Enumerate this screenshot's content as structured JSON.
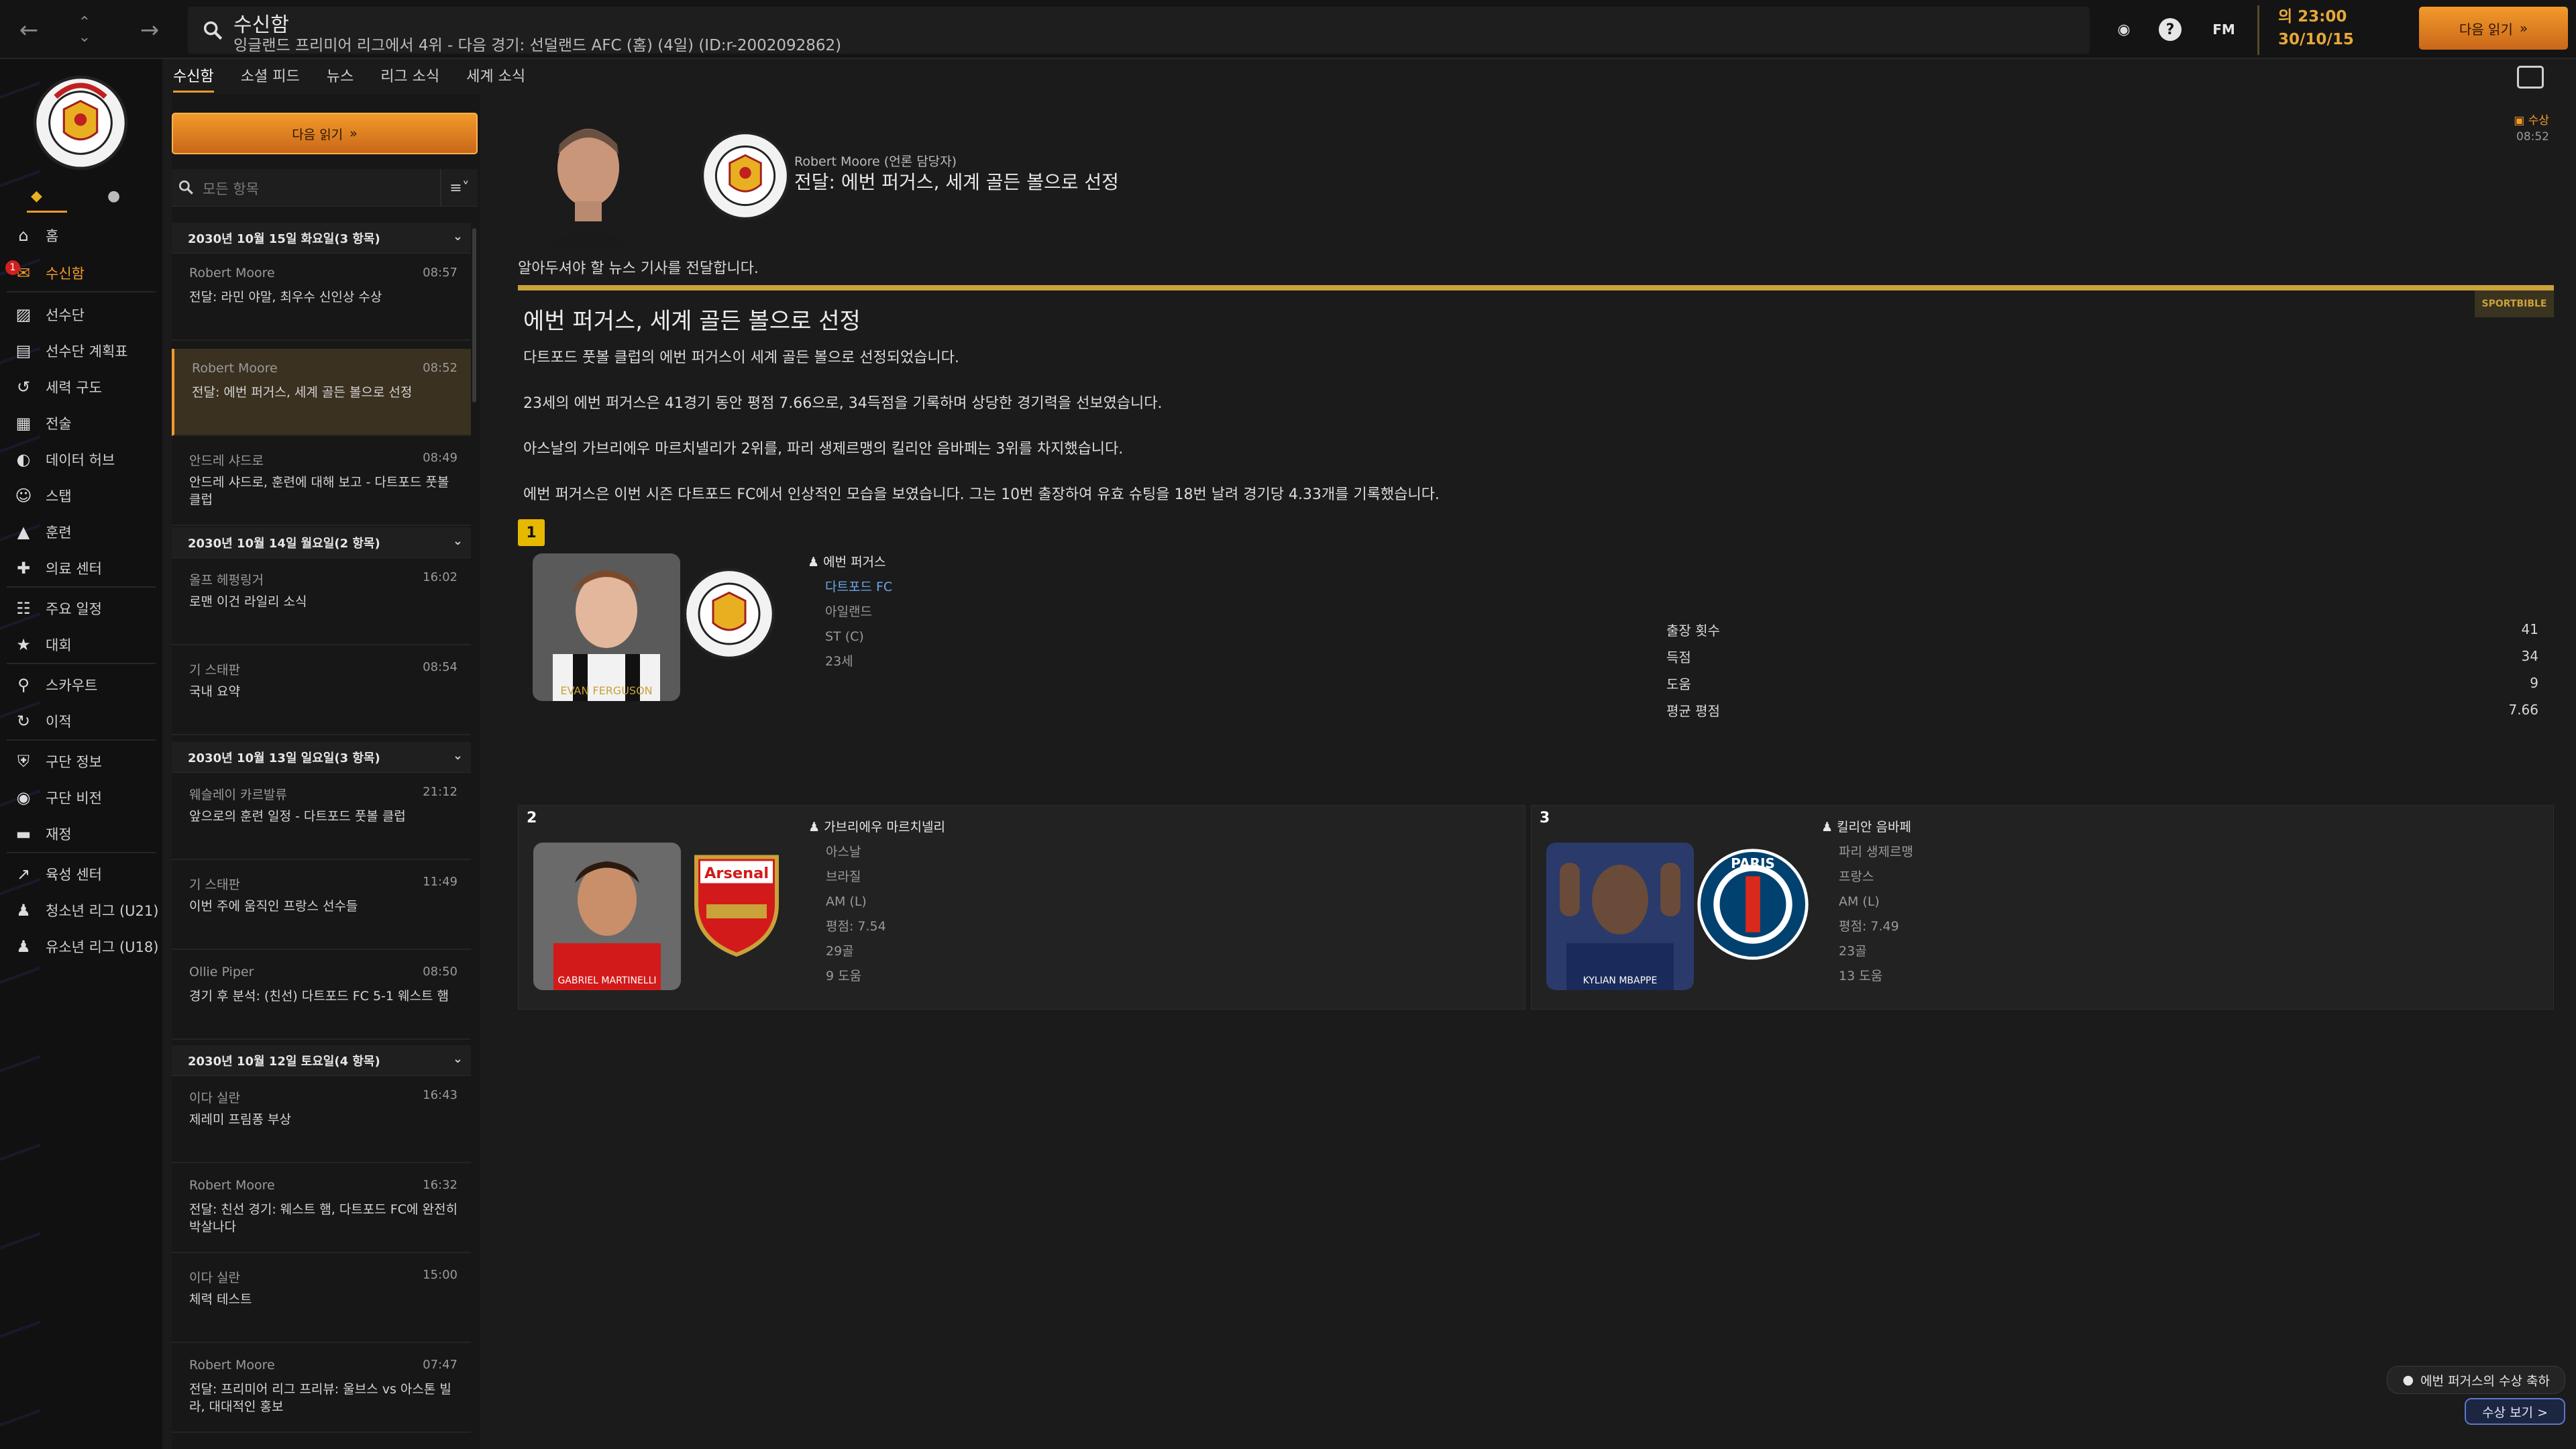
{
  "topbar": {
    "title": "수신함",
    "subtitle": "잉글랜드 프리미어 리그에서 4위 - 다음 경기: 선덜랜드 AFC (홈) (4일) (ID:r-2002092862)",
    "fm_label": "FM",
    "day_time": "의 23:00",
    "date": "30/10/15",
    "continue_label": "다음 읽기"
  },
  "sidebar": {
    "items": [
      {
        "label": "홈",
        "icon": "home-icon"
      },
      {
        "label": "수신함",
        "icon": "inbox-icon",
        "badge": "1"
      },
      {
        "label": "선수단",
        "icon": "shirt-icon"
      },
      {
        "label": "선수단 계획표",
        "icon": "clipboard-icon"
      },
      {
        "label": "세력 구도",
        "icon": "dynamics-icon"
      },
      {
        "label": "전술",
        "icon": "tactics-icon"
      },
      {
        "label": "데이터 허브",
        "icon": "data-icon"
      },
      {
        "label": "스탭",
        "icon": "staff-icon"
      },
      {
        "label": "훈련",
        "icon": "training-icon"
      },
      {
        "label": "의료 센터",
        "icon": "medical-icon"
      },
      {
        "label": "주요 일정",
        "icon": "calendar-icon"
      },
      {
        "label": "대회",
        "icon": "trophy-icon"
      },
      {
        "label": "스카우트",
        "icon": "scout-icon"
      },
      {
        "label": "이적",
        "icon": "transfer-icon"
      },
      {
        "label": "구단 정보",
        "icon": "shield-icon"
      },
      {
        "label": "구단 비전",
        "icon": "vision-icon"
      },
      {
        "label": "재정",
        "icon": "finance-icon"
      },
      {
        "label": "육성 센터",
        "icon": "development-icon"
      },
      {
        "label": "청소년 리그 (U21)",
        "icon": "u21-icon"
      },
      {
        "label": "유소년 리그 (U18)",
        "icon": "u18-icon"
      }
    ]
  },
  "subtabs": [
    "수신함",
    "소셜 피드",
    "뉴스",
    "리그 소식",
    "세계 소식"
  ],
  "list": {
    "continue_label": "다음 읽기",
    "filter_placeholder": "모든 항목",
    "groups": [
      {
        "date": "2030년 10월 15일 화요일(3 항목)"
      },
      {
        "date": "2030년 10월 14일 월요일(2 항목)"
      },
      {
        "date": "2030년 10월 13일 일요일(3 항목)"
      },
      {
        "date": "2030년 10월 12일 토요일(4 항목)"
      }
    ],
    "messages": [
      {
        "sender": "Robert Moore",
        "time": "08:57",
        "subject": "전달: 라민 야말, 최우수 신인상 수상"
      },
      {
        "sender": "Robert Moore",
        "time": "08:52",
        "subject": "전달: 에번 퍼거스, 세계 골든 볼으로 선정"
      },
      {
        "sender": "안드레 샤드로",
        "time": "08:49",
        "subject": "안드레 샤드로, 훈련에 대해 보고 - 다트포드 풋볼 클럽"
      },
      {
        "sender": "올프 헤펑링거",
        "time": "16:02",
        "subject": "로맨 이건 라일리 소식"
      },
      {
        "sender": "기 스태판",
        "time": "08:54",
        "subject": "국내 요약"
      },
      {
        "sender": "웨슬레이 카르발류",
        "time": "21:12",
        "subject": "앞으로의 훈련 일정 - 다트포드 풋볼 클럽"
      },
      {
        "sender": "기 스태판",
        "time": "11:49",
        "subject": "이번 주에 움직인 프랑스 선수들"
      },
      {
        "sender": "Ollie Piper",
        "time": "08:50",
        "subject": "경기 후 분석: (친선) 다트포드 FC 5-1 웨스트 햄"
      },
      {
        "sender": "이다 실란",
        "time": "16:43",
        "subject": "제레미 프림퐁 부상"
      },
      {
        "sender": "Robert Moore",
        "time": "16:32",
        "subject": "전달: 친선 경기: 웨스트 햄, 다트포드 FC에 완전히 박살나다"
      },
      {
        "sender": "이다 실란",
        "time": "15:00",
        "subject": "체력 테스트"
      },
      {
        "sender": "Robert Moore",
        "time": "07:47",
        "subject": "전달: 프리미어 리그 프리뷰: 울브스 vs 아스톤 빌라, 대대적인 홍보"
      }
    ]
  },
  "message": {
    "from": "Robert Moore (언론 담당자)",
    "title": "전달: 에번 퍼거스, 세계 골든 볼으로 선정",
    "award_tag": "수상",
    "award_time": "08:52",
    "intro": "알아두셔야 할 뉴스 기사를 전달합니다.",
    "source_brand": "SPORTBIBLE",
    "article_title": "에번 퍼거스, 세계 골든 볼으로 선정",
    "paragraphs": [
      "다트포드 풋볼 클럽의 에번 퍼거스이 세계 골든 볼으로 선정되었습니다.",
      "23세의 에번 퍼거스은 41경기 동안 평점 7.66으로, 34득점을 기록하며 상당한 경기력을 선보였습니다.",
      "아스날의 가브리에우 마르치넬리가 2위를, 파리 생제르맹의 킬리안 음바페는 3위를 차지했습니다.",
      "에번 퍼거스은 이번 시즌 다트포드 FC에서 인상적인 모습을 보였습니다. 그는 10번 출장하여 유효 슈팅을 18번 날려 경기당 4.33개를 기록했습니다."
    ],
    "winner": {
      "rank": "1",
      "name": "에번 퍼거스",
      "club": "다트포드 FC",
      "nation": "아일랜드",
      "position": "ST (C)",
      "age": "23세",
      "shirt_name": "EVAN FERGUSON",
      "stats": [
        {
          "label": "출장 횟수",
          "value": "41"
        },
        {
          "label": "득점",
          "value": "34"
        },
        {
          "label": "도움",
          "value": "9"
        },
        {
          "label": "평균 평점",
          "value": "7.66"
        }
      ]
    },
    "second": {
      "rank": "2",
      "name": "가브리에우 마르치넬리",
      "club": "아스날",
      "nation": "브라질",
      "position": "AM (L)",
      "rating": "평점: 7.54",
      "goals": "29골",
      "assists": "9 도움",
      "shirt_name": "GABRIEL MARTINELLI",
      "crest_text": "Arsenal"
    },
    "third": {
      "rank": "3",
      "name": "킬리안 음바페",
      "club": "파리 생제르맹",
      "nation": "프랑스",
      "position": "AM (L)",
      "rating": "평점: 7.49",
      "goals": "23골",
      "assists": "13 도움",
      "shirt_name": "KYLIAN MBAPPE",
      "crest_text": "PARIS"
    }
  },
  "bottom": {
    "award_button": "에번 퍼거스의 수상 축하",
    "view_button": "수상 보기 >"
  },
  "colors": {
    "accent": "#f39a2a",
    "gold": "#c9a23a",
    "link": "#6ea6e8"
  }
}
